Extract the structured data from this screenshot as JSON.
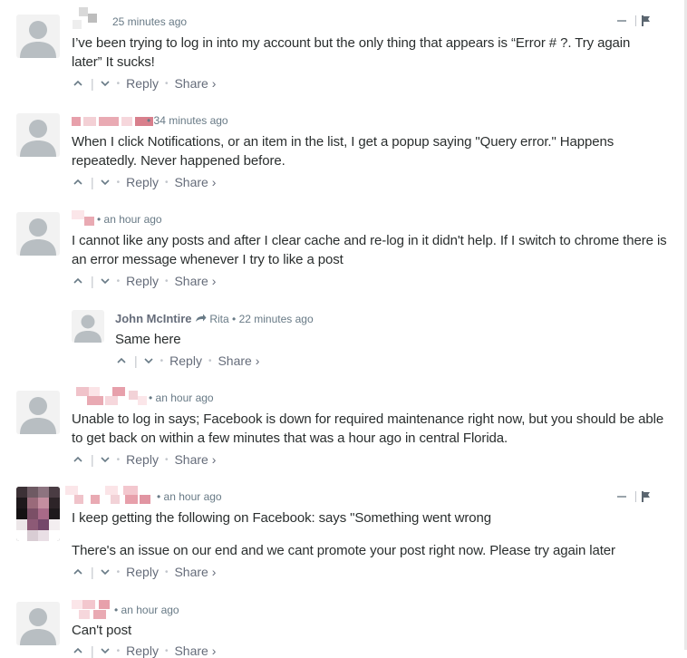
{
  "comments": [
    {
      "time": "25 minutes ago",
      "text": "I’ve been trying to log in into my account but the only thing that appears is “Error # ?. Try again later” It sucks!",
      "reply_label": "Reply",
      "share_label": "Share ›"
    },
    {
      "time": "34 minutes ago",
      "text": "When I click Notifications, or an item in the list, I get a popup saying \"Query error.\" Happens repeatedly. Never happened before.",
      "reply_label": "Reply",
      "share_label": "Share ›"
    },
    {
      "time": "an hour ago",
      "text": "I cannot like any posts and after I clear cache and re-log in it didn't help. If I switch to chrome there is an error message whenever I try to like a post",
      "reply_label": "Reply",
      "share_label": "Share ›"
    },
    {
      "author": "John McIntire",
      "reply_to": "Rita",
      "time": "22 minutes ago",
      "text": "Same here",
      "reply_label": "Reply",
      "share_label": "Share ›"
    },
    {
      "time": "an hour ago",
      "text": "Unable to log in says; Facebook is down for required maintenance right now, but you should be able to get back on within a few minutes that was a hour ago in central Florida.",
      "reply_label": "Reply",
      "share_label": "Share ›"
    },
    {
      "time": "an hour ago",
      "text": "I keep getting the following on Facebook: says \"Something went wrong",
      "text2": "There's an issue on our end and we cant promote your post right now. Please try again later",
      "reply_label": "Reply",
      "share_label": "Share ›"
    },
    {
      "time": "an hour ago",
      "text": "Can't post",
      "reply_label": "Reply",
      "share_label": "Share ›"
    }
  ],
  "icons": {
    "upvote": "chevron-up-icon",
    "downvote": "chevron-down-icon",
    "flag": "flag-icon",
    "collapse": "minus-icon",
    "reply_arrow": "reply-arrow-icon"
  },
  "colors": {
    "text": "#2a2e2e",
    "meta": "#687a86",
    "pixelated": "#e8a3ad"
  }
}
